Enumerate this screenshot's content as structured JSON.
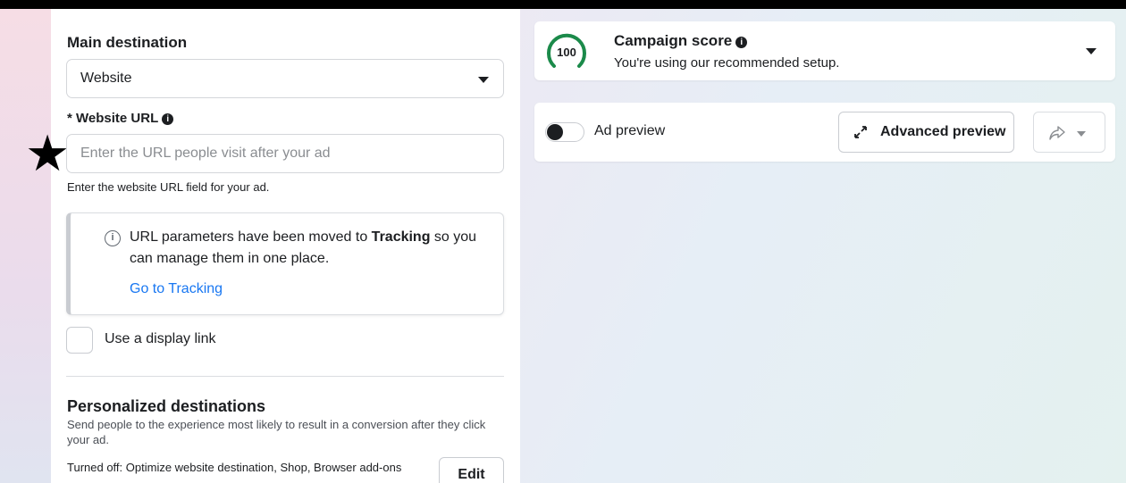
{
  "destination": {
    "main_label": "Main destination",
    "select_value": "Website",
    "url_label": "* Website URL",
    "url_placeholder": "Enter the URL people visit after your ad",
    "url_help": "Enter the website URL field for your ad.",
    "notice_line1_prefix": "URL parameters have been moved to ",
    "notice_line1_bold": "Tracking",
    "notice_line1_suffix": " so you",
    "notice_line2": "can manage them in one place.",
    "notice_link": "Go to Tracking",
    "display_link_label": "Use a display link"
  },
  "personalized": {
    "title": "Personalized destinations",
    "description": "Send people to the experience most likely to result in a conversion after they click your ad.",
    "status_prefix": "Turned off",
    "status_text": ": Optimize website destination, Shop, Browser add-ons",
    "edit_label": "Edit"
  },
  "campaign_score": {
    "value": "100",
    "value_fraction": 1.0,
    "title": "Campaign score",
    "subtitle": "You're using our recommended setup.",
    "accent_color": "#1b8a4a"
  },
  "preview": {
    "toggle_label": "Ad preview",
    "toggle_on": false,
    "advanced_label": "Advanced preview"
  },
  "icons": {
    "info": "info-icon",
    "expand": "expand-arrows-icon",
    "share": "share-arrow-icon",
    "annotation": "star-marker-icon"
  }
}
